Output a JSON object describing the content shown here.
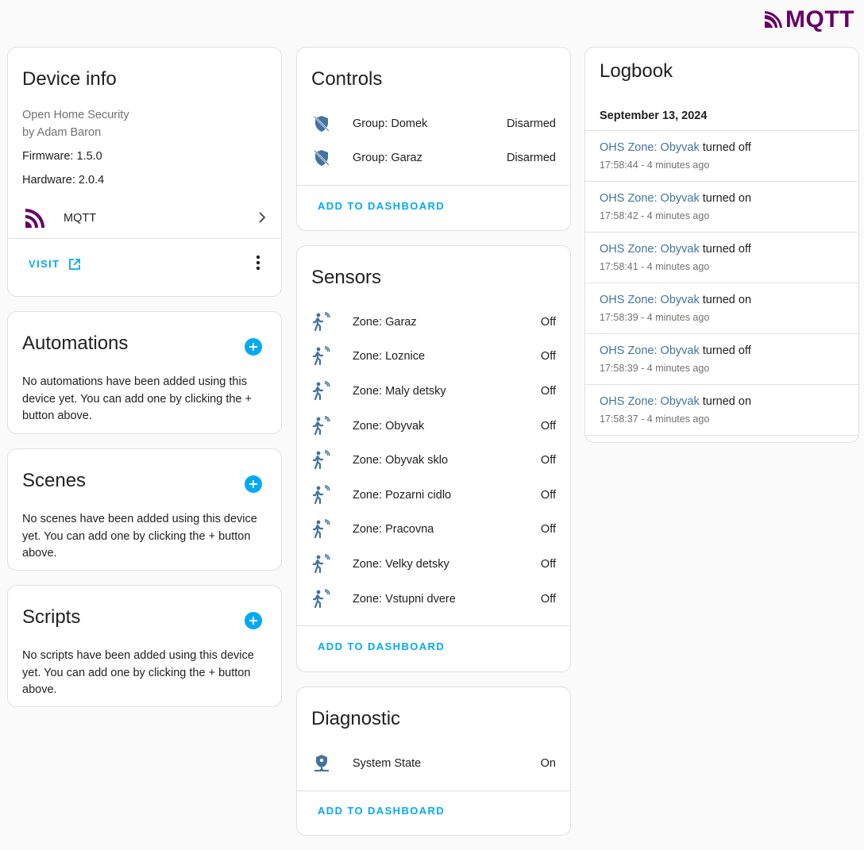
{
  "brand": {
    "logo_text": "MQTT",
    "color": "#660066"
  },
  "accent_color": "#03a9f4",
  "device_info": {
    "title": "Device info",
    "model": "Open Home Security",
    "manufacturer": "by Adam Baron",
    "firmware": "Firmware: 1.5.0",
    "hardware": "Hardware: 2.0.4",
    "integration_label": "MQTT",
    "visit_label": "VISIT"
  },
  "automations": {
    "title": "Automations",
    "empty_text": "No automations have been added using this device yet. You can add one by clicking the + button above."
  },
  "scenes": {
    "title": "Scenes",
    "empty_text": "No scenes have been added using this device yet. You can add one by clicking the + button above."
  },
  "scripts": {
    "title": "Scripts",
    "empty_text": "No scripts have been added using this device yet. You can add one by clicking the + button above."
  },
  "controls": {
    "title": "Controls",
    "items": [
      {
        "name": "Group: Domek",
        "state": "Disarmed",
        "icon": "shield-off-icon"
      },
      {
        "name": "Group: Garaz",
        "state": "Disarmed",
        "icon": "shield-off-icon"
      }
    ],
    "action_label": "ADD TO DASHBOARD"
  },
  "sensors": {
    "title": "Sensors",
    "items": [
      {
        "name": "Zone: Garaz",
        "state": "Off",
        "icon": "motion-sensor-icon"
      },
      {
        "name": "Zone: Loznice",
        "state": "Off",
        "icon": "motion-sensor-icon"
      },
      {
        "name": "Zone: Maly detsky",
        "state": "Off",
        "icon": "motion-sensor-icon"
      },
      {
        "name": "Zone: Obyvak",
        "state": "Off",
        "icon": "motion-sensor-icon"
      },
      {
        "name": "Zone: Obyvak sklo",
        "state": "Off",
        "icon": "motion-sensor-icon"
      },
      {
        "name": "Zone: Pozarni cidlo",
        "state": "Off",
        "icon": "motion-sensor-icon"
      },
      {
        "name": "Zone: Pracovna",
        "state": "Off",
        "icon": "motion-sensor-icon"
      },
      {
        "name": "Zone: Velky detsky",
        "state": "Off",
        "icon": "motion-sensor-icon"
      },
      {
        "name": "Zone: Vstupni dvere",
        "state": "Off",
        "icon": "motion-sensor-icon"
      }
    ],
    "action_label": "ADD TO DASHBOARD"
  },
  "diagnostic": {
    "title": "Diagnostic",
    "items": [
      {
        "name": "System State",
        "state": "On",
        "icon": "shield-network-icon"
      }
    ],
    "action_label": "ADD TO DASHBOARD"
  },
  "logbook": {
    "title": "Logbook",
    "date": "September 13, 2024",
    "entries": [
      {
        "entity": "OHS Zone: Obyvak",
        "action": "turned off",
        "time": "17:58:44 - 4 minutes ago"
      },
      {
        "entity": "OHS Zone: Obyvak",
        "action": "turned on",
        "time": "17:58:42 - 4 minutes ago"
      },
      {
        "entity": "OHS Zone: Obyvak",
        "action": "turned off",
        "time": "17:58:41 - 4 minutes ago"
      },
      {
        "entity": "OHS Zone: Obyvak",
        "action": "turned on",
        "time": "17:58:39 - 4 minutes ago"
      },
      {
        "entity": "OHS Zone: Obyvak",
        "action": "turned off",
        "time": "17:58:39 - 4 minutes ago"
      },
      {
        "entity": "OHS Zone: Obyvak",
        "action": "turned on",
        "time": "17:58:37 - 4 minutes ago"
      }
    ]
  }
}
